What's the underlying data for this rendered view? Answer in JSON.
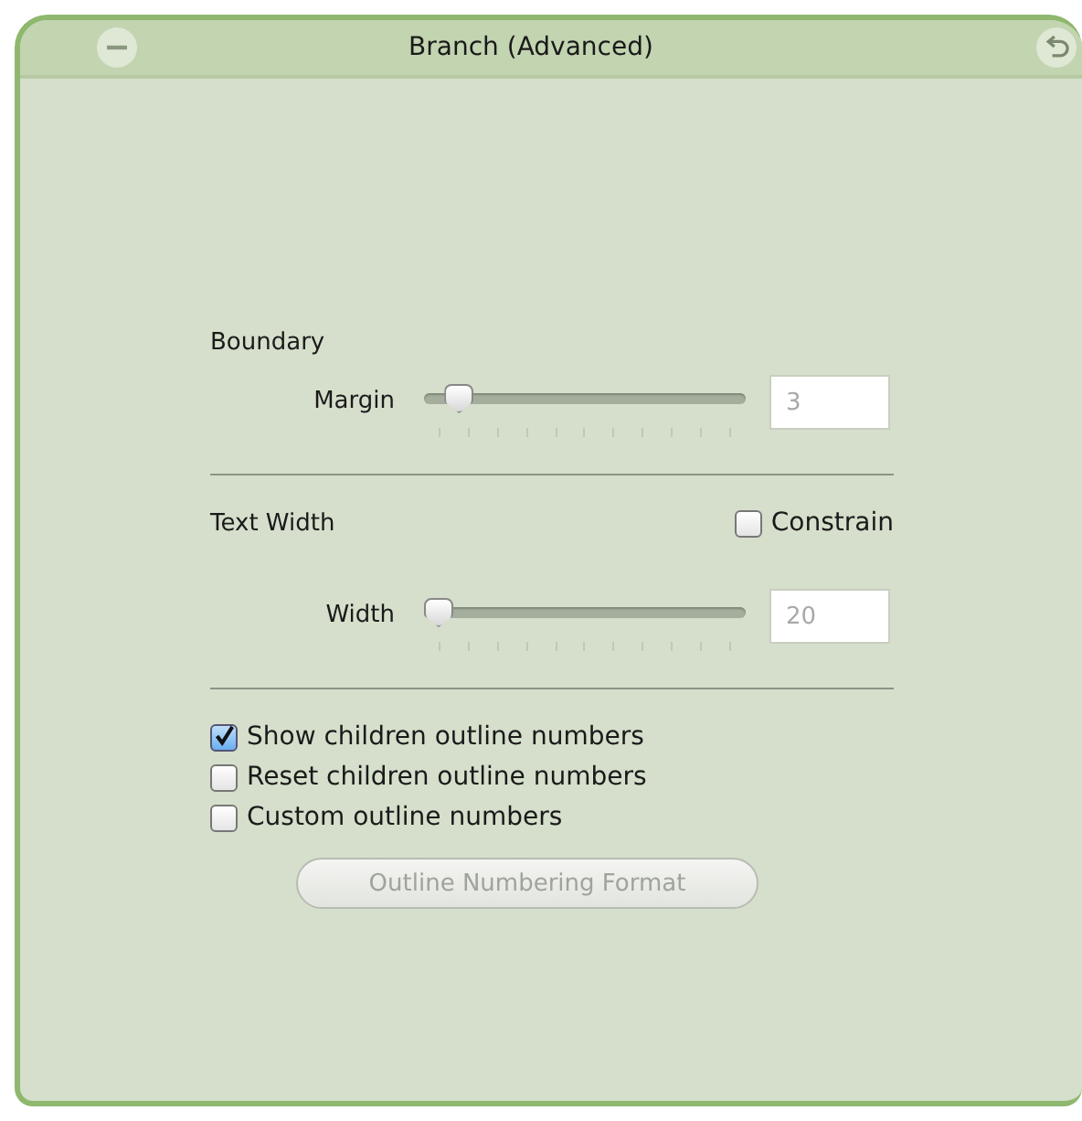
{
  "window": {
    "title": "Branch (Advanced)"
  },
  "boundary": {
    "heading": "Boundary",
    "slider": {
      "label": "Margin",
      "level": 0.07,
      "value": "3",
      "disabled": true
    }
  },
  "text_width": {
    "heading": "Text Width",
    "constrain": {
      "label": "Constrain",
      "checked": false
    },
    "slider": {
      "label": "Width",
      "level": 0,
      "value": "20",
      "disabled": true
    }
  },
  "options": [
    {
      "label": "Show children outline numbers",
      "checked": true
    },
    {
      "label": "Reset children outline numbers",
      "checked": false
    },
    {
      "label": "Custom outline numbers",
      "checked": false
    }
  ],
  "button": {
    "label": "Outline Numbering Format",
    "disabled": true
  }
}
